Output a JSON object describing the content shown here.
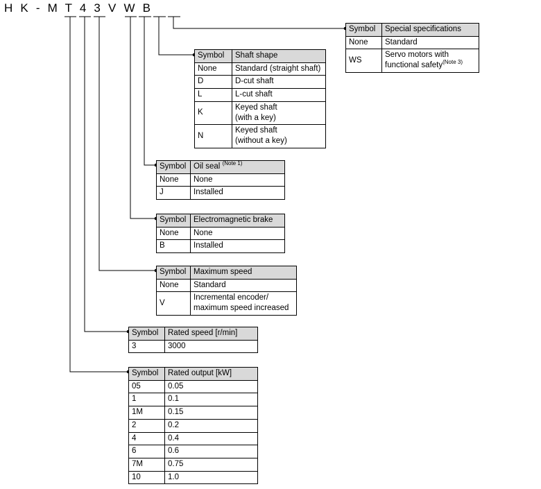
{
  "diagram": {
    "model_number": "H K - M T 4 3 V W B",
    "model_number_plain": "HK-MT43VWB"
  },
  "tables": {
    "special_specifications": {
      "name": "special-specifications",
      "header": {
        "symbol": "Symbol",
        "description": "Special specifications"
      },
      "rows": [
        {
          "symbol": "None",
          "description": "Standard"
        },
        {
          "symbol": "WS",
          "description_line1": "Servo motors with",
          "description_line2": "functional safety",
          "note": "(Note 3)"
        }
      ]
    },
    "shaft_shape": {
      "name": "shaft-shape",
      "header": {
        "symbol": "Symbol",
        "description": "Shaft shape"
      },
      "rows": [
        {
          "symbol": "None",
          "description": "Standard (straight shaft)"
        },
        {
          "symbol": "D",
          "description": "D-cut shaft"
        },
        {
          "symbol": "L",
          "description": "L-cut shaft"
        },
        {
          "symbol": "K",
          "description_line1": "Keyed shaft",
          "description_line2": "(with a key)"
        },
        {
          "symbol": "N",
          "description_line1": "Keyed shaft",
          "description_line2": "(without a key)"
        }
      ]
    },
    "oil_seal": {
      "name": "oil-seal",
      "header": {
        "symbol": "Symbol",
        "description": "Oil seal",
        "note": "(Note 1)"
      },
      "rows": [
        {
          "symbol": "None",
          "description": "None"
        },
        {
          "symbol": "J",
          "description": "Installed"
        }
      ]
    },
    "electromagnetic_brake": {
      "name": "electromagnetic-brake",
      "header": {
        "symbol": "Symbol",
        "description": "Electromagnetic brake"
      },
      "rows": [
        {
          "symbol": "None",
          "description": "None"
        },
        {
          "symbol": "B",
          "description": "Installed"
        }
      ]
    },
    "maximum_speed": {
      "name": "maximum-speed",
      "header": {
        "symbol": "Symbol",
        "description": "Maximum speed"
      },
      "rows": [
        {
          "symbol": "None",
          "description": "Standard"
        },
        {
          "symbol": "V",
          "description_line1": "Incremental encoder/",
          "description_line2": "maximum speed increased"
        }
      ]
    },
    "rated_speed": {
      "name": "rated-speed",
      "header": {
        "symbol": "Symbol",
        "description": "Rated speed [r/min]"
      },
      "rows": [
        {
          "symbol": "3",
          "description": "3000"
        }
      ]
    },
    "rated_output": {
      "name": "rated-output",
      "header": {
        "symbol": "Symbol",
        "description": "Rated output [kW]"
      },
      "rows": [
        {
          "symbol": "05",
          "description": "0.05"
        },
        {
          "symbol": "1",
          "description": "0.1"
        },
        {
          "symbol": "1M",
          "description": "0.15"
        },
        {
          "symbol": "2",
          "description": "0.2"
        },
        {
          "symbol": "4",
          "description": "0.4"
        },
        {
          "symbol": "6",
          "description": "0.6"
        },
        {
          "symbol": "7M",
          "description": "0.75"
        },
        {
          "symbol": "10",
          "description": "1.0"
        }
      ]
    }
  },
  "colors": {
    "header_fill": "#d9d9d9",
    "line": "#000000",
    "background": "#ffffff"
  }
}
